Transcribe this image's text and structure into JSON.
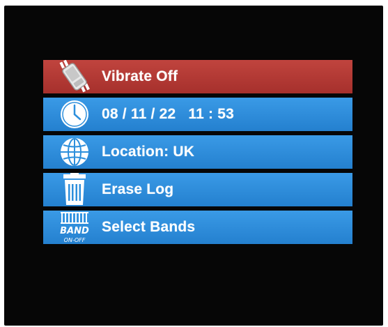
{
  "menu": {
    "items": [
      {
        "label": "Vibrate Off",
        "icon": "vibrate-icon",
        "selected": true
      },
      {
        "label": "08 / 11 / 22   11 : 53",
        "icon": "clock-icon",
        "selected": false
      },
      {
        "label": "Location: UK",
        "icon": "globe-icon",
        "selected": false
      },
      {
        "label": "Erase Log",
        "icon": "trash-icon",
        "selected": false
      },
      {
        "label": "Select Bands",
        "icon": "band-icon",
        "selected": false
      }
    ]
  },
  "icons": {
    "band": {
      "line1": "BAND",
      "line2": "ON-OFF"
    }
  },
  "colors": {
    "selected": "#a6302c",
    "item": "#2d8fdc",
    "screen": "#060606",
    "text": "#ffffff"
  }
}
